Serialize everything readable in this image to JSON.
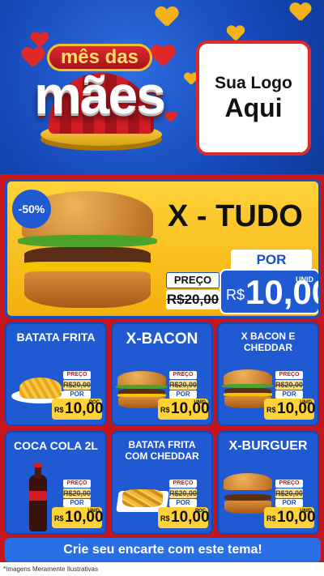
{
  "header": {
    "campaign_top": "mês das",
    "campaign_big": "mães",
    "logo_line1": "Sua Logo",
    "logo_line2": "Aqui"
  },
  "featured": {
    "discount": "-50%",
    "title": "X - TUDO",
    "old_label": "PREÇO",
    "old_price": "R$20,00",
    "por_label": "POR",
    "currency": "R$",
    "new_price": "10,00",
    "unit": "UNID"
  },
  "products": [
    {
      "name": "BATATA FRITA",
      "preco_label": "PREÇO",
      "old": "R$20,00",
      "por": "POR",
      "cur": "R$",
      "price": "10,00",
      "unit": "POC"
    },
    {
      "name": "X-BACON",
      "preco_label": "PREÇO",
      "old": "R$20,00",
      "por": "POR",
      "cur": "R$",
      "price": "10,00",
      "unit": "UNID"
    },
    {
      "name": "X BACON E CHEDDAR",
      "preco_label": "PREÇO",
      "old": "R$20,00",
      "por": "POR",
      "cur": "R$",
      "price": "10,00",
      "unit": "UNID"
    },
    {
      "name": "COCA COLA 2L",
      "preco_label": "PREÇO",
      "old": "R$20,00",
      "por": "POR",
      "cur": "R$",
      "price": "10,00",
      "unit": "UNID"
    },
    {
      "name": "BATATA FRITA COM CHEDDAR",
      "preco_label": "PREÇO",
      "old": "R$20,00",
      "por": "POR",
      "cur": "R$",
      "price": "10,00",
      "unit": "POC"
    },
    {
      "name": "X-BURGUER",
      "preco_label": "PREÇO",
      "old": "R$20,00",
      "por": "POR",
      "cur": "R$",
      "price": "10,00",
      "unit": "UNID"
    }
  ],
  "cta": "Crie seu encarte com este tema!",
  "disclaimer": "*Imagens Meramente Ilustrativas",
  "colors": {
    "blue": "#1f5ad3",
    "red": "#c4161c",
    "yellow": "#ffd23a"
  }
}
